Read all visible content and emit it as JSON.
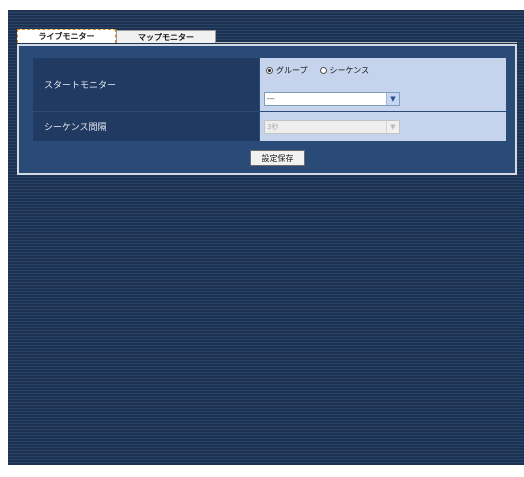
{
  "tabs": [
    {
      "label": "ライブモニター",
      "active": true
    },
    {
      "label": "マップモニター",
      "active": false
    }
  ],
  "start_monitor": {
    "label": "スタートモニター",
    "options": [
      {
        "label": "グループ",
        "selected": true
      },
      {
        "label": "シーケンス",
        "selected": false
      }
    ],
    "select_value": "---"
  },
  "sequence_interval": {
    "label": "シーケンス間隔",
    "select_value": "3秒",
    "disabled": true
  },
  "save_button": {
    "label": "設定保存"
  },
  "icons": {
    "select_arrow": "chevron-down-icon",
    "radio": "radio-icon"
  },
  "colors": {
    "background": "#1f3554",
    "panel": "#2a4a78",
    "label_cell": "#203a62",
    "value_cell": "#c5d4ec",
    "active_tab_border": "#d48a12"
  }
}
